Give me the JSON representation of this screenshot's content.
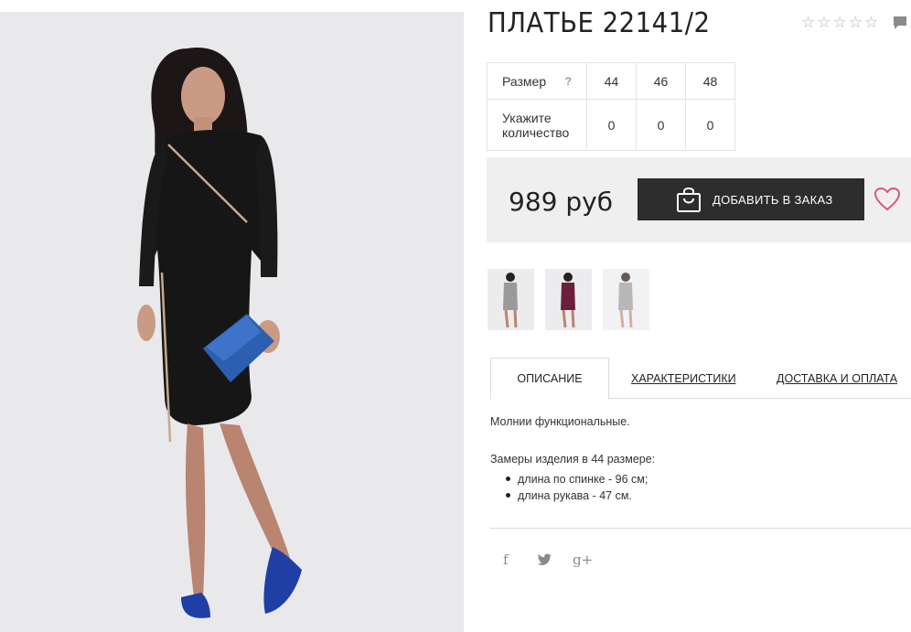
{
  "product": {
    "title": "ПЛАТЬЕ 22141/2",
    "rating_stars": 5
  },
  "sizes_table": {
    "size_label": "Размер",
    "help": "?",
    "sizes": [
      "44",
      "46",
      "48"
    ],
    "quantity_label": "Укажите количество",
    "quantities": [
      "0",
      "0",
      "0"
    ]
  },
  "purchase": {
    "price": "989 руб",
    "add_button": "ДОБАВИТЬ В ЗАКАЗ"
  },
  "tabs": [
    "ОПИСАНИЕ",
    "ХАРАКТЕРИСТИКИ",
    "ДОСТАВКА И ОПЛАТА"
  ],
  "description": {
    "line1": "Молнии функциональные.",
    "line2": "Замеры изделия в 44 размере:",
    "items": [
      "длина по спинке - 96 см;",
      "длина рукава - 47 см."
    ]
  },
  "social": {
    "facebook": "f",
    "twitter": "t",
    "google": "g+"
  },
  "colors": {
    "button_bg": "#2d2d2d",
    "price_box_bg": "#efefef",
    "heart": "#d9587a"
  }
}
